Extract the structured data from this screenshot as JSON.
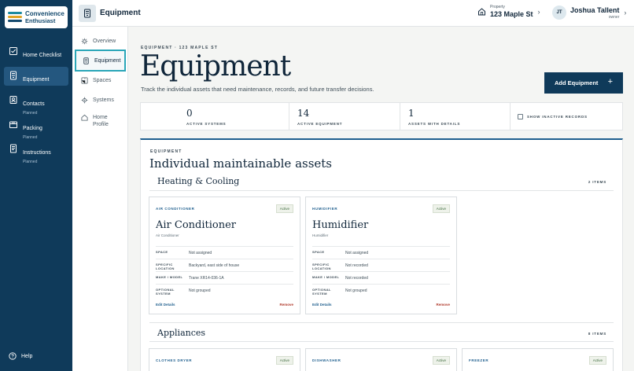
{
  "app": {
    "logo_line1": "Convenience",
    "logo_line2": "Enthusiast"
  },
  "sidebar": {
    "items": [
      {
        "label": "Home Checklist",
        "sub": ""
      },
      {
        "label": "Equipment",
        "sub": ""
      },
      {
        "label": "Contacts",
        "sub": "Planned"
      },
      {
        "label": "Packing",
        "sub": "Planned"
      },
      {
        "label": "Instructions",
        "sub": "Planned"
      }
    ],
    "help_label": "Help"
  },
  "header": {
    "title": "Equipment",
    "property_caption": "Property",
    "property_name": "123 Maple St",
    "user_initials": "JT",
    "user_name": "Joshua Tallent",
    "user_role": "owner"
  },
  "subnav": {
    "items": [
      {
        "label": "Overview"
      },
      {
        "label": "Equipment"
      },
      {
        "label": "Spaces"
      },
      {
        "label": "Systems"
      },
      {
        "label": "Home Profile"
      }
    ]
  },
  "main": {
    "eyebrow": "EQUIPMENT · 123 MAPLE ST",
    "title": "Equipment",
    "description": "Track the individual assets that need maintenance, records, and future transfer decisions.",
    "add_button": "Add Equipment",
    "add_button_icon": "+"
  },
  "stats": [
    {
      "value": "0",
      "label": "ACTIVE SYSTEMS"
    },
    {
      "value": "14",
      "label": "ACTIVE EQUIPMENT"
    },
    {
      "value": "1",
      "label": "ASSETS WITH DETAILS"
    }
  ],
  "inactive_toggle": {
    "label": "SHOW INACTIVE RECORDS",
    "checked": false
  },
  "panel": {
    "eyebrow": "EQUIPMENT",
    "title": "Individual maintainable assets"
  },
  "groups": [
    {
      "title": "Heating & Cooling",
      "count": "2 ITEMS"
    },
    {
      "title": "Appliances",
      "count": "8 ITEMS"
    }
  ],
  "row_keys": {
    "space": "SPACE",
    "location": "SPECIFIC LOCATION",
    "make_model": "MAKE / MODEL",
    "system": "OPTIONAL SYSTEM"
  },
  "cards": [
    {
      "eyebrow": "AIR CONDITIONER",
      "badge": "Active",
      "title": "Air Conditioner",
      "subtitle": "Air Conditioner",
      "space": "Not assigned",
      "location": "Backyard, east side of house",
      "make_model": "Trane XR14-036-1A",
      "system": "Not grouped",
      "edit": "Edit Details",
      "remove": "Remove"
    },
    {
      "eyebrow": "HUMIDIFIER",
      "badge": "Active",
      "title": "Humidifier",
      "subtitle": "Humidifier",
      "space": "Not assigned",
      "location": "Not recorded",
      "make_model": "Not recorded",
      "system": "Not grouped",
      "edit": "Edit Details",
      "remove": "Remove"
    }
  ],
  "appliance_cards": [
    {
      "eyebrow": "CLOTHES DRYER",
      "badge": "Active"
    },
    {
      "eyebrow": "DISHWASHER",
      "badge": "Active"
    },
    {
      "eyebrow": "FREEZER",
      "badge": "Active"
    }
  ],
  "colors": {
    "sidebar_bg": "#0f3a5a",
    "accent": "#1f5f8e",
    "focus": "#2aa6b8",
    "danger": "#b0392b"
  }
}
